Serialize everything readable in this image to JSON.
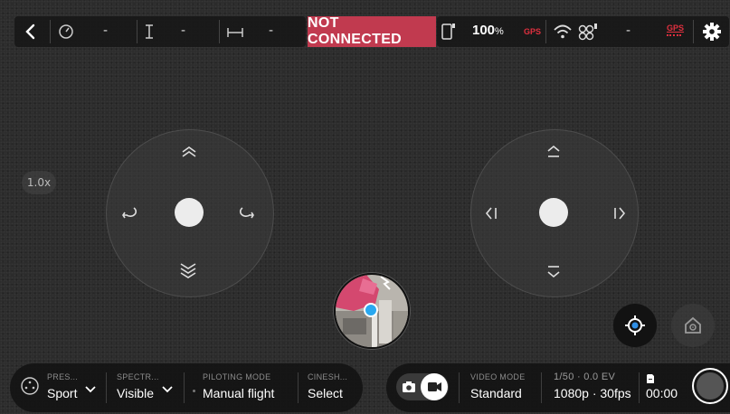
{
  "top_bar": {
    "speed_value": "-",
    "altitude_value": "-",
    "distance_value": "-",
    "connection_status": "NOT CONNECTED",
    "battery_percent": "100",
    "battery_unit": "%",
    "gps_label_left": "GPS",
    "signal_value": "-",
    "gps_label_right": "GPS"
  },
  "zoom_label": "1.0x",
  "bottom_left": {
    "preset_label": "PRES...",
    "preset_value": "Sport",
    "spectrum_label": "SPECTR...",
    "spectrum_value": "Visible",
    "piloting_label": "PILOTING MODE",
    "piloting_value": "Manual flight",
    "cinesh_label": "CINESH...",
    "cinesh_value": "Select"
  },
  "bottom_right": {
    "video_mode_label": "VIDEO MODE",
    "video_mode_value": "Standard",
    "exposure_label": "1/50 · 0.0 EV",
    "resolution_value": "1080p · 30fps",
    "record_time": "00:00"
  },
  "colors": {
    "not_connected_bg": "#c13a4f",
    "gps_red": "#e0303f",
    "location_blue": "#29a8f0"
  }
}
